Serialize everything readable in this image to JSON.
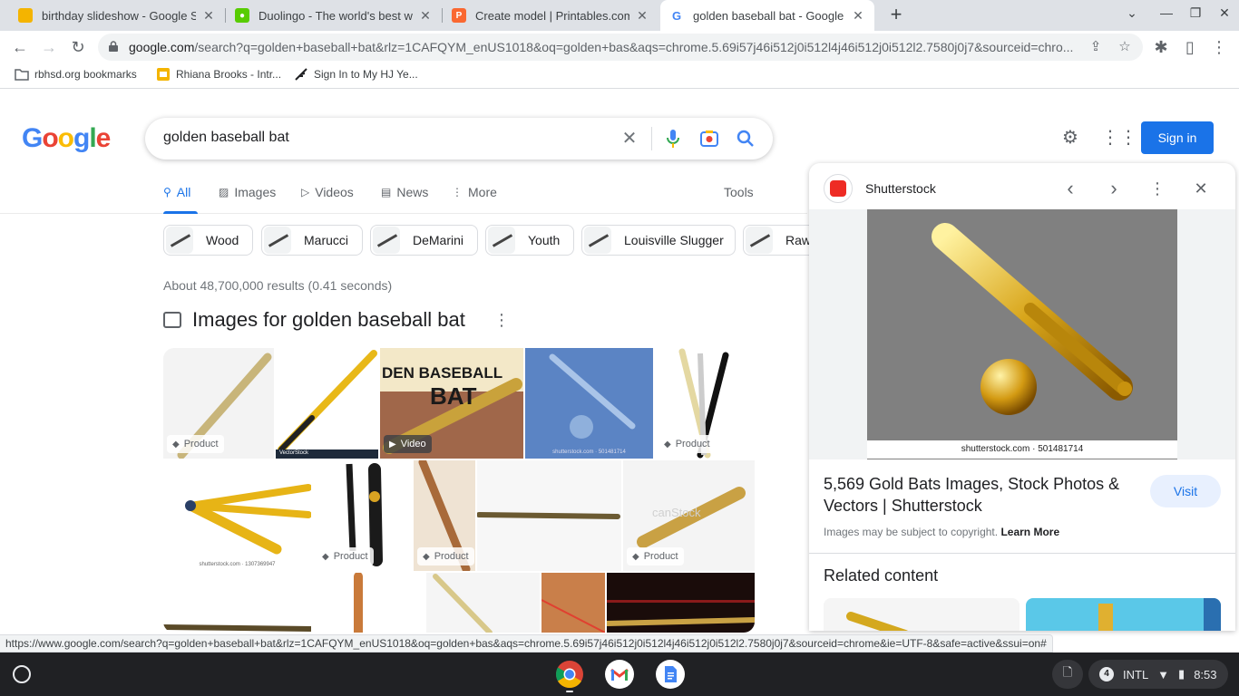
{
  "browser": {
    "tabs": [
      {
        "title": "birthday slideshow - Google Slides",
        "favicon": "slides-icon",
        "color": "#f4b400"
      },
      {
        "title": "Duolingo - The world's best way to learn",
        "favicon": "duolingo-icon",
        "color": "#58cc02"
      },
      {
        "title": "Create model | Printables.com",
        "favicon": "printables-icon",
        "color": "#fa6831"
      },
      {
        "title": "golden baseball bat - Google Search",
        "favicon": "google-icon",
        "color": "#4285f4"
      }
    ],
    "url_host": "google.com",
    "url_path": "/search?q=golden+baseball+bat&rlz=1CAFQYM_enUS1018&oq=golden+bas&aqs=chrome.5.69i57j46i512j0i512l4j46i512j0i512l2.7580j0j7&sourceid=chro...",
    "bookmarks": [
      {
        "label": "rbhsd.org bookmarks",
        "icon": "folder-icon"
      },
      {
        "label": "Rhiana Brooks - Intr...",
        "icon": "slides-icon"
      },
      {
        "label": "Sign In to My HJ Ye...",
        "icon": "feather-icon"
      }
    ]
  },
  "google": {
    "logo": "Google",
    "query": "golden baseball bat",
    "signin_label": "Sign in",
    "tabs": [
      {
        "label": "All",
        "icon": "search-icon"
      },
      {
        "label": "Images",
        "icon": "image-icon"
      },
      {
        "label": "Videos",
        "icon": "play-icon"
      },
      {
        "label": "News",
        "icon": "news-icon"
      },
      {
        "label": "More",
        "icon": "more-vert-icon"
      }
    ],
    "tools_label": "Tools",
    "chips": [
      "Wood",
      "Marucci",
      "DeMarini",
      "Youth",
      "Louisville Slugger",
      "Rawl"
    ],
    "stats": "About 48,700,000 results (0.41 seconds)",
    "images_header": "Images for golden baseball bat",
    "grid_badges": {
      "product": "Product",
      "video": "Video"
    },
    "grid_text": {
      "banner": "DEN BASEBALL",
      "banner2": "BAT",
      "vs_logo": "VectorStock",
      "sstk1": "shutterstock.com · 501481714",
      "sstk2": "shutterstock.com · 1307369947",
      "canstock": "canStock"
    }
  },
  "panel": {
    "source": "Shutterstock",
    "caption": "shutterstock.com · 501481714",
    "title": "5,569 Gold Bats Images, Stock Photos & Vectors | Shutterstock",
    "visit_label": "Visit",
    "copyright_text": "Images may be subject to copyright.",
    "learn_more": "Learn More",
    "related_label": "Related content"
  },
  "status_url": "https://www.google.com/search?q=golden+baseball+bat&rlz=1CAFQYM_enUS1018&oq=golden+bas&aqs=chrome.5.69i57j46i512j0i512l4j46i512j0i512l2.7580j0j7&sourceid=chrome&ie=UTF-8&safe=active&ssui=on#",
  "shelf": {
    "apps": [
      "chrome-icon",
      "gmail-icon",
      "docs-icon"
    ],
    "notification_count": "4",
    "ime": "INTL",
    "time": "8:53"
  }
}
